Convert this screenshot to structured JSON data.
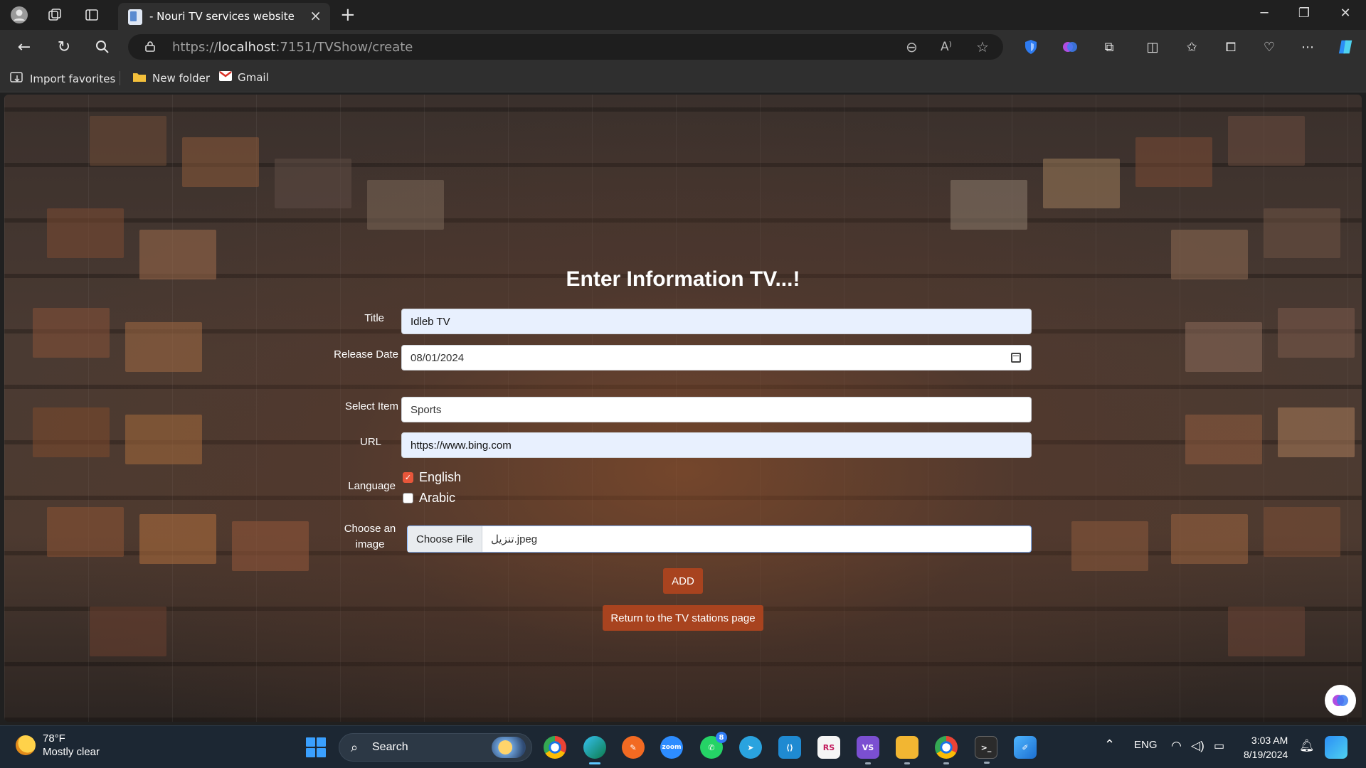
{
  "browser": {
    "tab_title": "- Nouri TV services website",
    "url_prefix": "https://",
    "url_host": "localhost",
    "url_rest": ":7151/TVShow/create"
  },
  "favorites": [
    {
      "label": "Import favorites",
      "icon": "import-icon"
    },
    {
      "label": "New folder",
      "icon": "folder-icon"
    },
    {
      "label": "Gmail",
      "icon": "gmail-icon"
    }
  ],
  "form": {
    "heading": "Enter Information TV...!",
    "title_label": "Title",
    "title_value": "Idleb TV",
    "release_label": "Release Date",
    "release_value": "08/01/2024",
    "select_label": "Select Item",
    "select_value": "Sports",
    "url_label": "URL",
    "url_value": "https://www.bing.com",
    "language_label": "Language",
    "languages": [
      {
        "label": "English",
        "checked": true
      },
      {
        "label": "Arabic",
        "checked": false
      }
    ],
    "image_label_line1": "Choose an",
    "image_label_line2": "image",
    "file_button": "Choose File",
    "file_name": "تنزيل.jpeg",
    "add_button": "ADD",
    "return_button": "Return to the TV stations page"
  },
  "colors": {
    "accent_button": "#a8431f",
    "checkbox": "#e8563a"
  },
  "taskbar": {
    "weather_temp": "78°F",
    "weather_desc": "Mostly clear",
    "search_label": "Search",
    "whatsapp_badge": "8",
    "language": "ENG",
    "time": "3:03 AM",
    "date": "8/19/2024",
    "zoom_label": "zoom"
  }
}
